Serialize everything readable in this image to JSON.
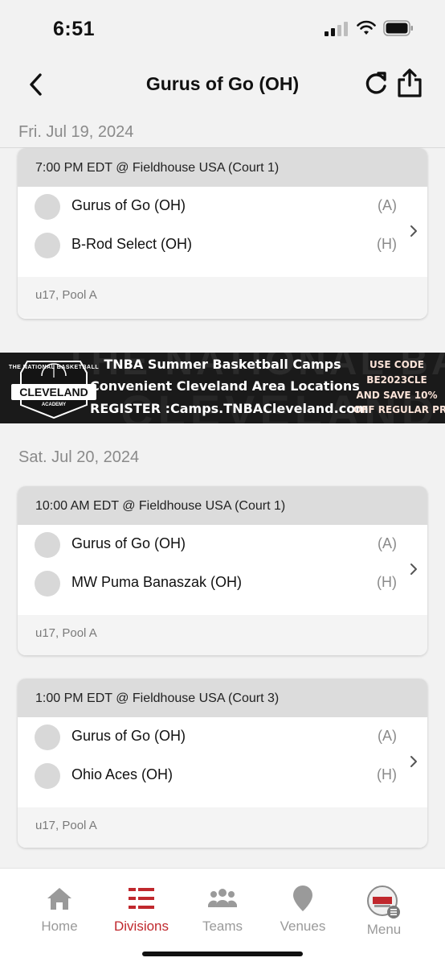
{
  "status_bar": {
    "time": "6:51"
  },
  "nav": {
    "title": "Gurus of Go (OH)"
  },
  "days": [
    {
      "date": "Fri. Jul 19, 2024",
      "games": [
        {
          "header": "7:00 PM EDT @ Fieldhouse USA (Court 1)",
          "teams": [
            {
              "name": "Gurus of Go (OH)",
              "tag": "(A)"
            },
            {
              "name": "B-Rod Select (OH)",
              "tag": "(H)"
            }
          ],
          "footer": "u17, Pool A"
        }
      ]
    },
    {
      "date": "Sat. Jul 20, 2024",
      "games": [
        {
          "header": "10:00 AM EDT @ Fieldhouse USA (Court 1)",
          "teams": [
            {
              "name": "Gurus of Go (OH)",
              "tag": "(A)"
            },
            {
              "name": "MW Puma Banaszak (OH)",
              "tag": "(H)"
            }
          ],
          "footer": "u17, Pool A"
        },
        {
          "header": "1:00 PM EDT @ Fieldhouse USA (Court 3)",
          "teams": [
            {
              "name": "Gurus of Go (OH)",
              "tag": "(A)"
            },
            {
              "name": "Ohio Aces (OH)",
              "tag": "(H)"
            }
          ],
          "footer": "u17, Pool A"
        }
      ]
    }
  ],
  "ad": {
    "logo_top": "THE NATIONAL BASKETBALL",
    "logo_main": "CLEVELAND",
    "logo_sub": "ACADEMY",
    "line1": "TNBA Summer Basketball Camps",
    "line2": "Convenient Cleveland Area Locations",
    "line3": "REGISTER :Camps.TNBACleveland.com",
    "promo1": "USE CODE",
    "promo2": "BE2023CLE",
    "promo3": "AND SAVE 10%",
    "promo4": "OFF REGULAR PRICE",
    "bg_text1": "THE NATIONAL BASKETBALL",
    "bg_text2": "CLEVELAND",
    "promo_color": "#fbe3d8"
  },
  "tabs": [
    {
      "label": "Home",
      "icon": "home-icon",
      "active": false
    },
    {
      "label": "Divisions",
      "icon": "divisions-icon",
      "active": true
    },
    {
      "label": "Teams",
      "icon": "teams-icon",
      "active": false
    },
    {
      "label": "Venues",
      "icon": "venues-icon",
      "active": false
    },
    {
      "label": "Menu",
      "icon": "menu-icon",
      "active": false
    }
  ],
  "colors": {
    "accent": "#c0282d",
    "inactive": "#9a9a9a",
    "background": "#f2f2f2"
  }
}
